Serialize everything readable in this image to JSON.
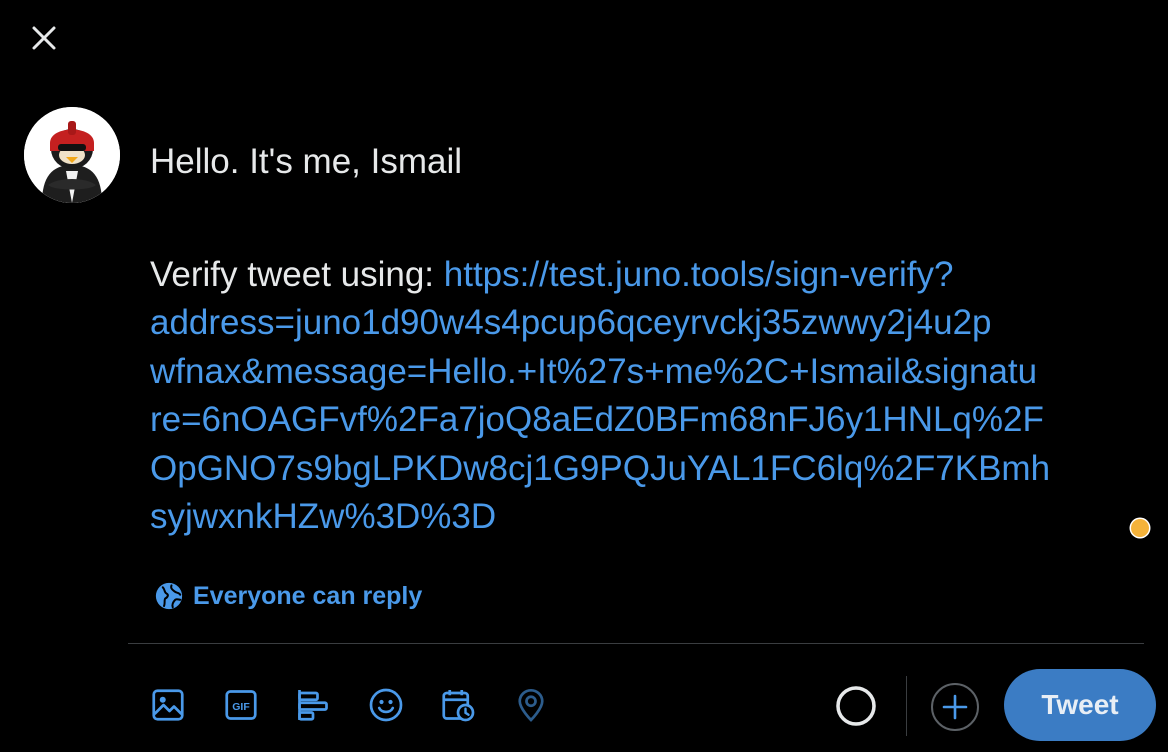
{
  "header": {
    "close_icon": "close-icon"
  },
  "composer": {
    "line1": "Hello. It's me, Ismail",
    "verify_label": "Verify tweet using: ",
    "url_line1": "https://test.juno.tools/sign-verify?",
    "url_lines": [
      "address=juno1d90w4s4pcup6qceyrvckj35zwwy2j4u2p",
      "wfnax&message=Hello.+It%27s+me%2C+Ismail&signatu",
      "re=6nOAGFvf%2Fa7joQ8aEdZ0BFm68nFJ6y1HNLq%2F",
      "OpGNO7s9bgLPKDw8cj1G9PQJuYAL1FC6lq%2F7KBmh",
      "syjwxnkHZw%3D%3D"
    ]
  },
  "reply_setting": {
    "label": "Everyone can reply",
    "icon": "globe-icon"
  },
  "toolbar": {
    "icons": [
      "image-icon",
      "gif-icon",
      "poll-icon",
      "emoji-icon",
      "schedule-icon",
      "location-icon"
    ]
  },
  "actions": {
    "tweet_label": "Tweet",
    "add_icon": "plus-icon"
  },
  "colors": {
    "background": "#000000",
    "text": "#e7e9ea",
    "accent": "#4a99e9",
    "tweet_button": "#3b7cc4",
    "grammarly_dot": "#f4b23a"
  }
}
